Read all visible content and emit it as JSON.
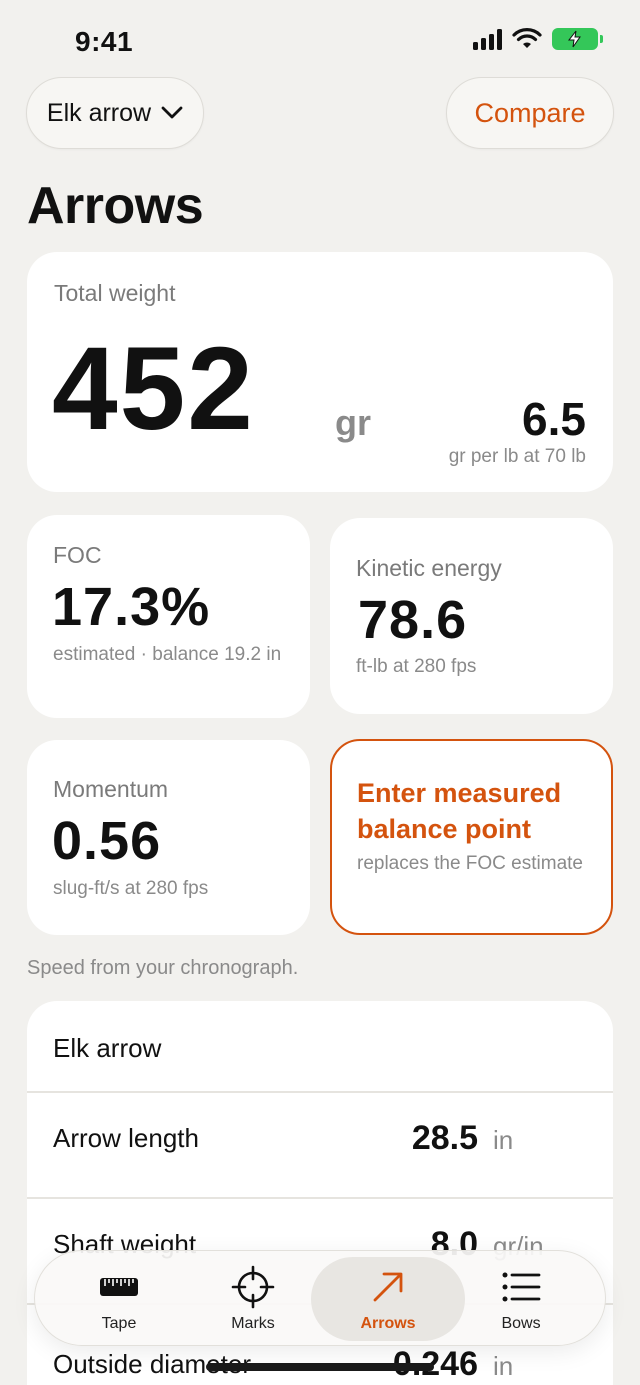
{
  "status_bar": {
    "time": "9:41"
  },
  "header": {
    "arrow_select_label": "Elk arrow",
    "compare_label": "Compare"
  },
  "page_title": "Arrows",
  "total_weight": {
    "label": "Total weight",
    "value": "452",
    "unit": "gr",
    "ratio_value": "6.5",
    "ratio_sub": "gr per lb at 70 lb"
  },
  "foc": {
    "label": "FOC",
    "value": "17.3%",
    "sub": "estimated · balance 19.2 in"
  },
  "kinetic_energy": {
    "label": "Kinetic energy",
    "value": "78.6",
    "sub": "ft-lb at 280 fps"
  },
  "momentum": {
    "label": "Momentum",
    "value": "0.56",
    "sub": "slug-ft/s at 280 fps"
  },
  "balance_point": {
    "title": "Enter measured balance point",
    "sub": "replaces the FOC estimate"
  },
  "speed_note": "Speed from your chronograph.",
  "spec_list": {
    "title": "Elk arrow",
    "rows": [
      {
        "label": "Arrow length",
        "value": "28.5",
        "unit": "in"
      },
      {
        "label": "Shaft weight",
        "value": "8.0",
        "unit": "gr/in"
      },
      {
        "label": "Outside diameter",
        "value": "0.246",
        "unit": "in"
      }
    ]
  },
  "tab_bar": {
    "tabs": [
      {
        "label": "Tape",
        "icon": "ruler-icon"
      },
      {
        "label": "Marks",
        "icon": "crosshair-icon"
      },
      {
        "label": "Arrows",
        "icon": "arrow-up-right-icon",
        "active": true
      },
      {
        "label": "Bows",
        "icon": "list-icon"
      }
    ]
  },
  "colors": {
    "accent": "#d4530e",
    "background": "#f2f1ee",
    "card": "#ffffff",
    "muted_text": "#8a8a8a",
    "battery": "#34c759"
  }
}
